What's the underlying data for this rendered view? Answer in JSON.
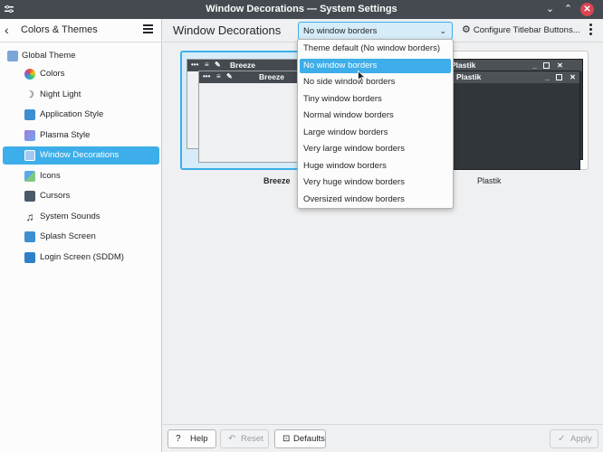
{
  "window": {
    "title": "Window Decorations — System Settings"
  },
  "sidebar": {
    "back_label": "Colors & Themes",
    "items": [
      {
        "label": "Global Theme",
        "icon": "global-theme-icon"
      },
      {
        "label": "Colors",
        "icon": "colors-icon"
      },
      {
        "label": "Night Light",
        "icon": "night-light-icon"
      },
      {
        "label": "Application Style",
        "icon": "application-style-icon"
      },
      {
        "label": "Plasma Style",
        "icon": "plasma-style-icon"
      },
      {
        "label": "Window Decorations",
        "icon": "window-decorations-icon",
        "active": true
      },
      {
        "label": "Icons",
        "icon": "icons-icon"
      },
      {
        "label": "Cursors",
        "icon": "cursors-icon"
      },
      {
        "label": "System Sounds",
        "icon": "system-sounds-icon"
      },
      {
        "label": "Splash Screen",
        "icon": "splash-screen-icon"
      },
      {
        "label": "Login Screen (SDDM)",
        "icon": "login-screen-icon"
      }
    ]
  },
  "header": {
    "page_title": "Window Decorations",
    "border_size": "No window borders",
    "configure_label": "Configure Titlebar Buttons..."
  },
  "dropdown": {
    "options": [
      "Theme default (No window borders)",
      "No window borders",
      "No side window borders",
      "Tiny window borders",
      "Normal window borders",
      "Large window borders",
      "Very large window borders",
      "Huge window borders",
      "Very huge window borders",
      "Oversized window borders"
    ],
    "selected_index": 1
  },
  "themes": [
    {
      "name": "Breeze",
      "window_title": "Breeze",
      "selected": true
    },
    {
      "name": "Plastik",
      "window_title": "Plastik",
      "selected": false
    }
  ],
  "footer": {
    "help": "Help",
    "reset": "Reset",
    "defaults": "Defaults",
    "apply": "Apply"
  },
  "colors": {
    "accent": "#3daee9",
    "titlebar": "#444a50",
    "close": "#da4453"
  }
}
